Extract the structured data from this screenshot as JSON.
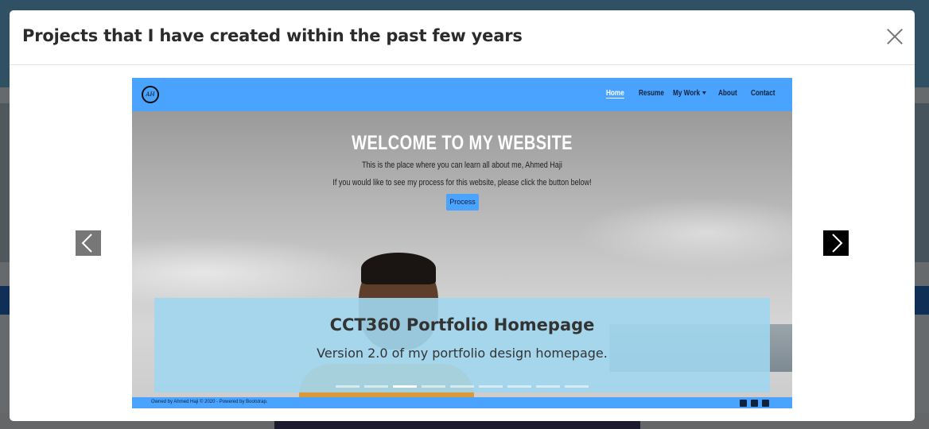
{
  "modal": {
    "title": "Projects that I have created within the past few years"
  },
  "slide": {
    "site": {
      "logo_text": "AH",
      "nav": [
        "Home",
        "Resume",
        "My Work",
        "About",
        "Contact"
      ],
      "hero_title": "WELCOME TO MY WEBSITE",
      "hero_line1": "This is the place where you can learn all about me, Ahmed Haji",
      "hero_line2": "If you would like to see my process for this website, please click the button below!",
      "hero_button": "Process",
      "footer_text": "Owned by Ahmed Haji © 2020 - Powered by Bootstrap."
    },
    "caption": {
      "title": "CCT360 Portfolio Homepage",
      "text": "Version 2.0 of my portfolio design homepage."
    }
  },
  "carousel": {
    "indicator_count": 9,
    "active_index": 2
  },
  "icons": {
    "close": "close-icon",
    "prev": "chevron-left-icon",
    "next": "chevron-right-icon",
    "social": [
      "linkedin-icon",
      "twitter-icon",
      "instagram-icon"
    ]
  }
}
